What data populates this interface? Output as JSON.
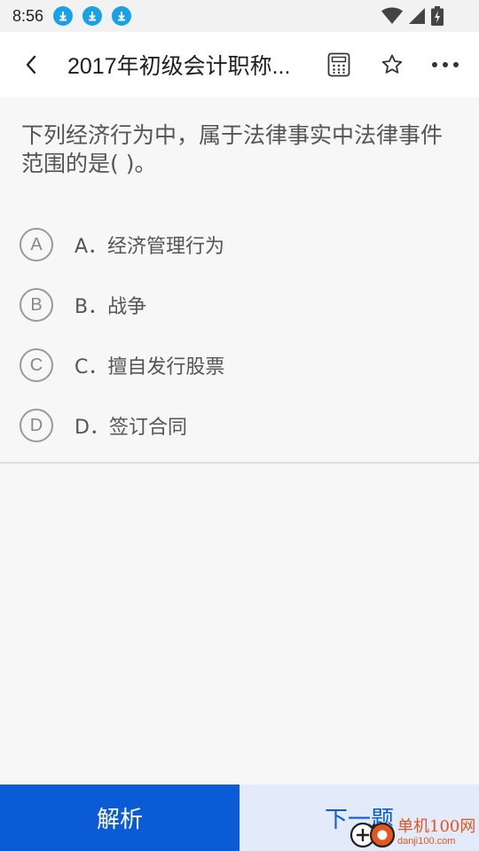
{
  "status_bar": {
    "time": "8:56",
    "download_icons": [
      "download-icon",
      "download-icon",
      "download-icon"
    ],
    "right_icons": [
      "wifi-icon",
      "signal-icon",
      "battery-charging-icon"
    ]
  },
  "header": {
    "title": "2017年初级会计职称...",
    "back_icon": "chevron-left-icon",
    "actions": [
      "calculator-icon",
      "star-icon",
      "more-icon"
    ]
  },
  "question": {
    "text": "下列经济行为中，属于法律事实中法律事件范围的是(    )。",
    "options": [
      {
        "letter": "A",
        "label": "A．经济管理行为"
      },
      {
        "letter": "B",
        "label": "B．战争"
      },
      {
        "letter": "C",
        "label": "C．擅自发行股票"
      },
      {
        "letter": "D",
        "label": "D．签订合同"
      }
    ]
  },
  "bottom_bar": {
    "analysis_label": "解析",
    "next_label": "下一题"
  },
  "watermark": {
    "name": "单机100网",
    "url": "danji100.com"
  },
  "colors": {
    "primary": "#0b5bd6",
    "secondary_bg": "#e3ebfb",
    "download_badge": "#17a2e8",
    "watermark": "#e8541c"
  }
}
